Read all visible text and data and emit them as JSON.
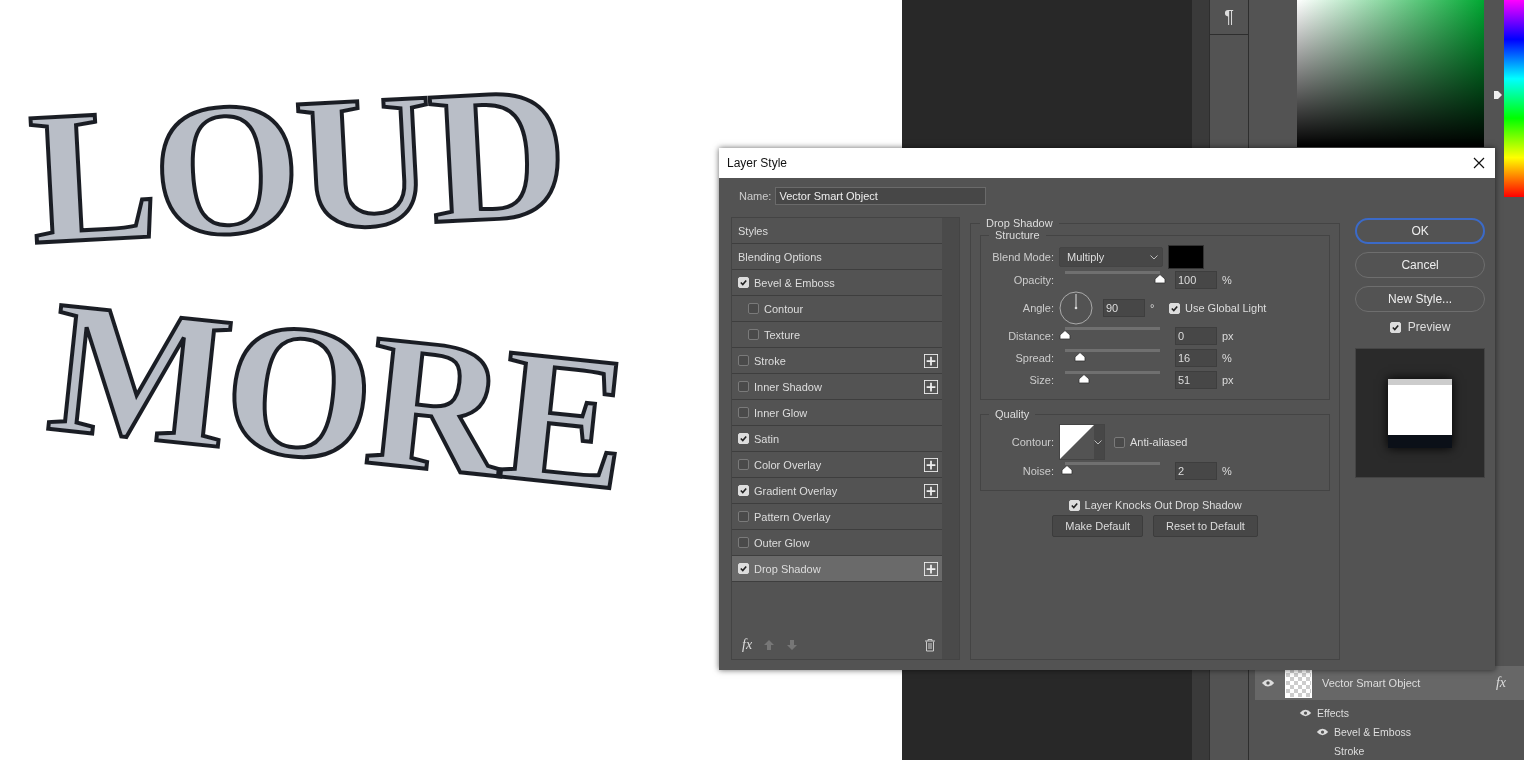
{
  "canvas": {
    "lines": [
      "LOUD",
      "MORE"
    ]
  },
  "tool_column": {
    "glyph": "¶"
  },
  "layers_panel": {
    "layer": {
      "name": "Vector Smart Object",
      "visible": true,
      "fx": "fx"
    },
    "effects": [
      {
        "label": "Effects",
        "visible": true,
        "children": [
          {
            "label": "Bevel & Emboss",
            "visible": true
          },
          {
            "label": "Stroke",
            "visible": false
          }
        ]
      }
    ]
  },
  "dialog": {
    "title": "Layer Style",
    "name_label": "Name:",
    "name_value": "Vector Smart Object",
    "styles": [
      {
        "kind": "header",
        "label": "Styles",
        "selected": false
      },
      {
        "kind": "header",
        "label": "Blending Options",
        "selected": false
      },
      {
        "kind": "effect",
        "label": "Bevel & Emboss",
        "checked": true,
        "selected": false,
        "addable": false,
        "children": [
          {
            "kind": "effect",
            "label": "Contour",
            "checked": false,
            "selected": false,
            "addable": false
          },
          {
            "kind": "effect",
            "label": "Texture",
            "checked": false,
            "selected": false,
            "addable": false
          }
        ]
      },
      {
        "kind": "effect",
        "label": "Stroke",
        "checked": false,
        "selected": false,
        "addable": true
      },
      {
        "kind": "effect",
        "label": "Inner Shadow",
        "checked": false,
        "selected": false,
        "addable": true
      },
      {
        "kind": "effect",
        "label": "Inner Glow",
        "checked": false,
        "selected": false,
        "addable": false
      },
      {
        "kind": "effect",
        "label": "Satin",
        "checked": true,
        "selected": false,
        "addable": false
      },
      {
        "kind": "effect",
        "label": "Color Overlay",
        "checked": false,
        "selected": false,
        "addable": true
      },
      {
        "kind": "effect",
        "label": "Gradient Overlay",
        "checked": true,
        "selected": false,
        "addable": true
      },
      {
        "kind": "effect",
        "label": "Pattern Overlay",
        "checked": false,
        "selected": false,
        "addable": false
      },
      {
        "kind": "effect",
        "label": "Outer Glow",
        "checked": false,
        "selected": false,
        "addable": false
      },
      {
        "kind": "effect",
        "label": "Drop Shadow",
        "checked": true,
        "selected": true,
        "addable": true
      }
    ],
    "list_toolbar": {
      "fx": "fx",
      "move_up_disabled": true,
      "move_down_disabled": true
    },
    "section_title": "Drop Shadow",
    "structure": {
      "title": "Structure",
      "blend_label": "Blend Mode:",
      "blend_value": "Multiply",
      "rows": [
        {
          "kind": "slider",
          "label": "Opacity:",
          "value": "100",
          "unit": "%",
          "level": 1
        },
        {
          "kind": "angle",
          "label": "Angle:",
          "value": "90",
          "unit": "°",
          "option": {
            "label": "Use Global Light",
            "checked": true
          }
        },
        {
          "kind": "slider",
          "label": "Distance:",
          "value": "0",
          "unit": "px",
          "level": 0
        },
        {
          "kind": "slider",
          "label": "Spread:",
          "value": "16",
          "unit": "%",
          "level": 0.16
        },
        {
          "kind": "slider",
          "label": "Size:",
          "value": "51",
          "unit": "px",
          "level": 0.2
        }
      ]
    },
    "quality": {
      "title": "Quality",
      "contour_label": "Contour:",
      "anti_aliased": {
        "label": "Anti-aliased",
        "checked": false
      },
      "rows": [
        {
          "kind": "slider",
          "label": "Noise:",
          "value": "2",
          "unit": "%",
          "level": 0.02
        }
      ]
    },
    "knockout": {
      "label": "Layer Knocks Out Drop Shadow",
      "checked": true
    },
    "defaults_buttons": [
      "Make Default",
      "Reset to Default"
    ],
    "side_buttons": [
      {
        "label": "OK",
        "selected": true
      },
      {
        "label": "Cancel",
        "selected": false
      },
      {
        "label": "New Style...",
        "selected": false
      }
    ],
    "preview": {
      "label": "Preview",
      "checked": true
    }
  }
}
